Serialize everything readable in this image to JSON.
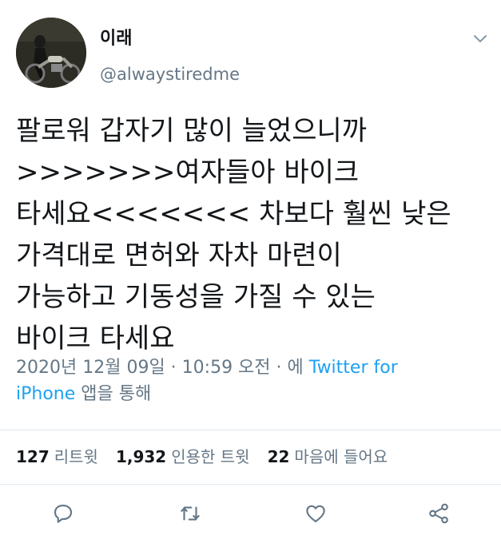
{
  "tweet": {
    "display_name": "이래",
    "handle": "@alwaystiredme",
    "text_lines": [
      "팔로워 갑자기 많이 늘었으니까",
      ">>>>>>>여자들아 바이크",
      "타세요<<<<<<< 차보다 훨씬 낮은",
      "가격대로 면허와 자차 마련이",
      "가능하고 기동성을 가질 수 있는",
      "바이크 타세요"
    ],
    "timestamp": "2020년 12월 09일 · 10:59 오전 · 에",
    "source_line1": "Twitter for",
    "source_line2": "iPhone",
    "source_suffix": "앱을 통해"
  },
  "stats": {
    "retweets_count": "127",
    "retweets_label": "리트윗",
    "quotes_count": "1,932",
    "quotes_label": "인용한 트윗",
    "likes_count": "22",
    "likes_label": "마음에 들어요"
  },
  "actions": {
    "reply_icon": "reply-icon",
    "retweet_icon": "retweet-icon",
    "like_icon": "heart-icon",
    "share_icon": "share-icon"
  },
  "colors": {
    "text": "#14171a",
    "muted": "#657786",
    "link": "#1da1f2",
    "divider": "#e1e8ed"
  }
}
